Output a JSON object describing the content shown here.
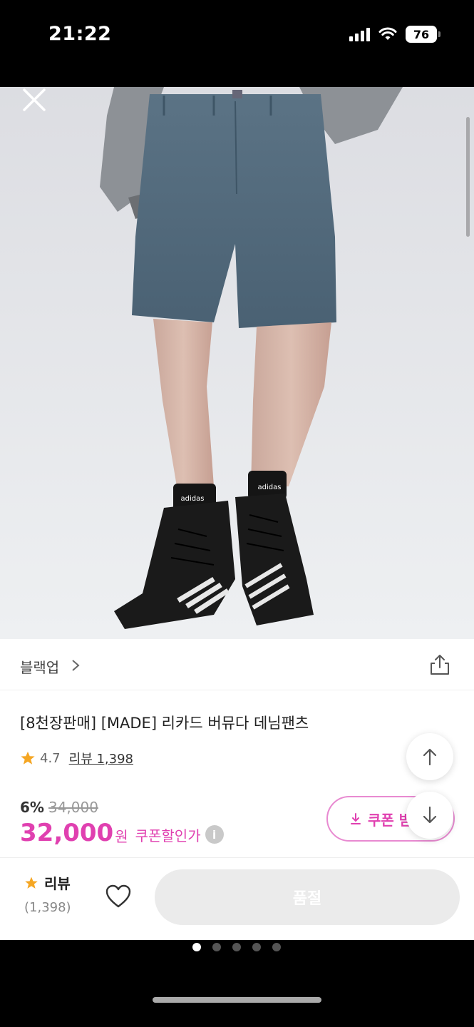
{
  "status": {
    "time": "21:22",
    "battery": "76"
  },
  "brand": {
    "name": "블랙업"
  },
  "product": {
    "title": "[8천장판매] [MADE] 리카드 버뮤다 데님팬츠",
    "rating": "4.7",
    "review_link": "리뷰 1,398",
    "discount": "6%",
    "original_price": "34,000",
    "price": "32,000",
    "currency": "원",
    "coupon_label": "쿠폰할인가",
    "info_icon": "i"
  },
  "coupon_button": {
    "label": "쿠폰 받"
  },
  "bottom_bar": {
    "review_label": "리뷰",
    "review_count": "(1,398)",
    "soldout_label": "품절"
  },
  "icons": {
    "close": "close-icon",
    "share": "share-icon",
    "star": "star-icon",
    "heart": "heart-icon",
    "arrow_up": "arrow-up-icon",
    "arrow_down": "arrow-down-icon",
    "download": "download-icon"
  },
  "colors": {
    "accent": "#e040b0",
    "star": "#f5a623",
    "soldout_bg": "#ebebeb"
  },
  "pager": {
    "total": 5,
    "active": 1
  }
}
